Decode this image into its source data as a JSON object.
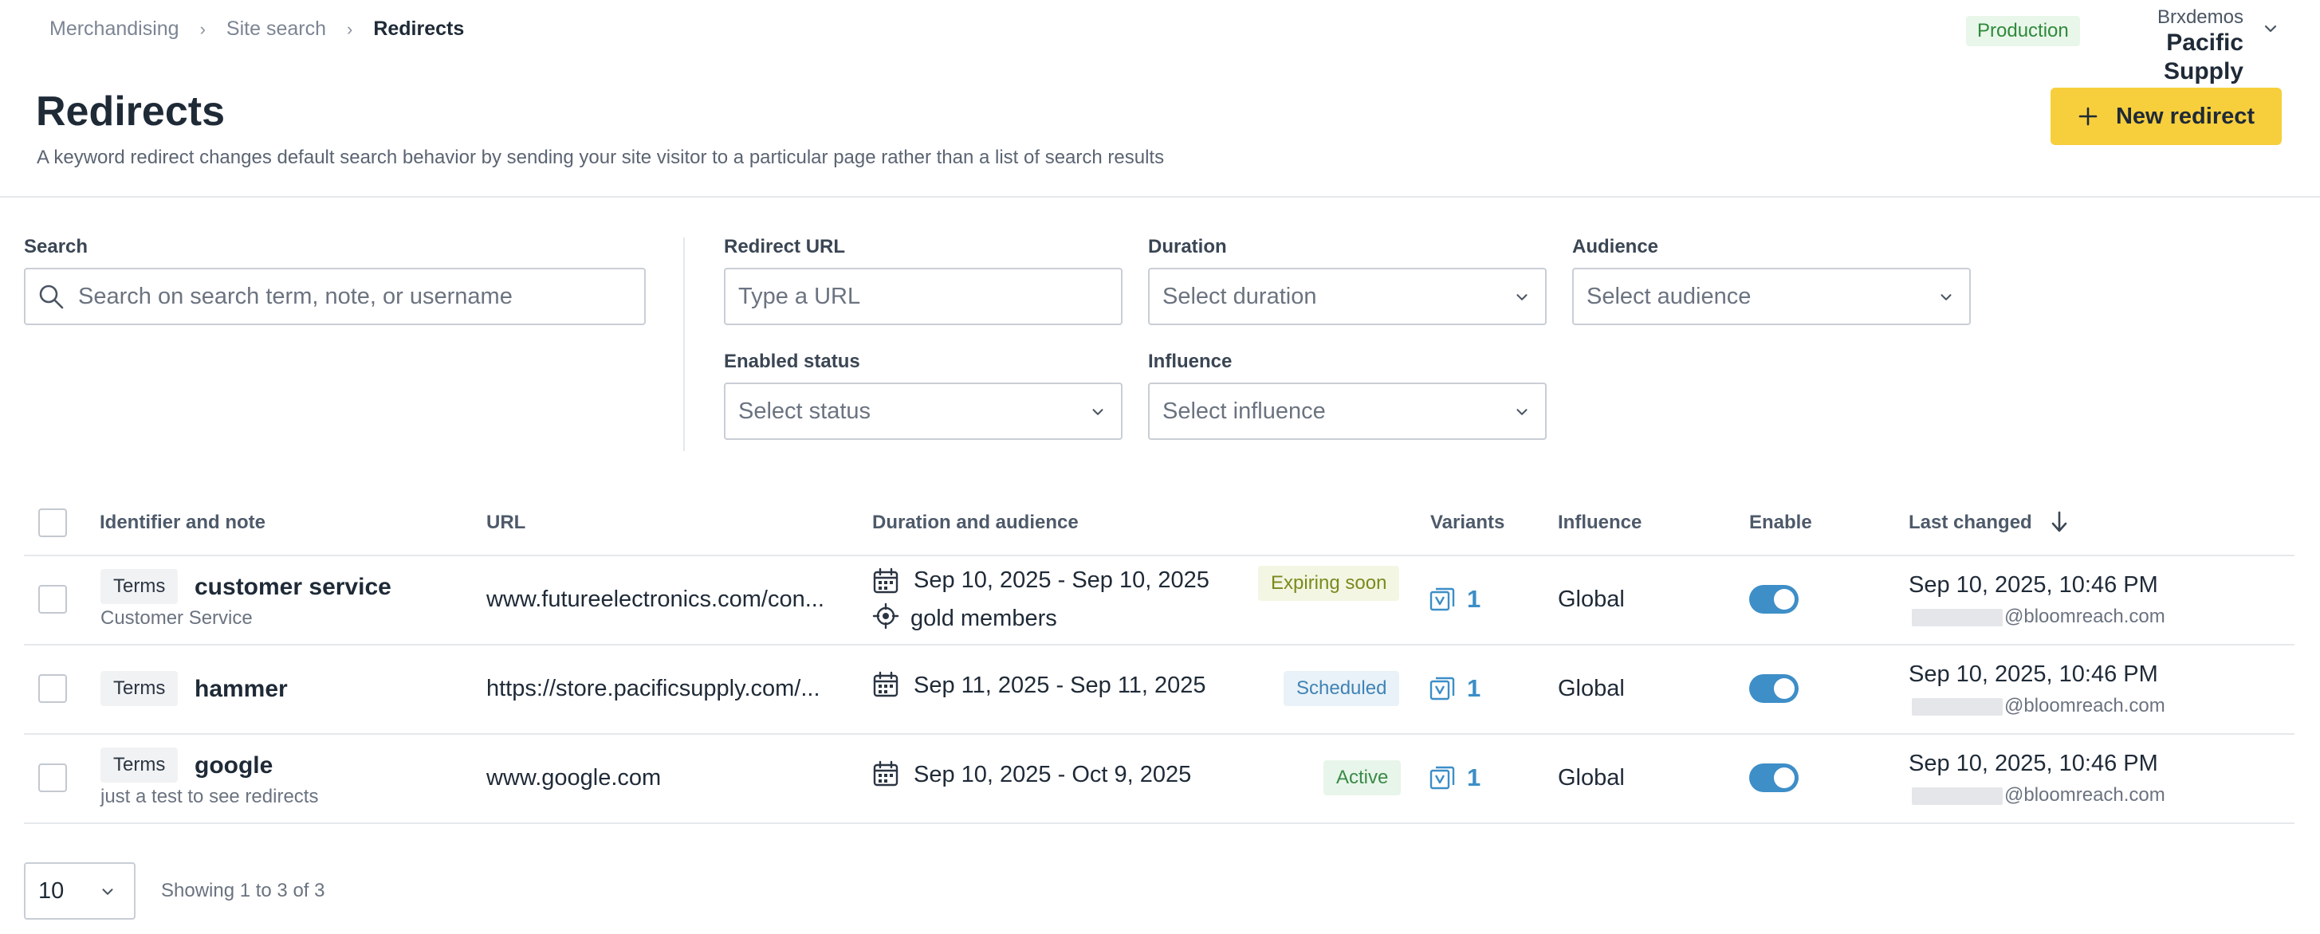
{
  "breadcrumb": [
    "Merchandising",
    "Site search",
    "Redirects"
  ],
  "environment": "Production",
  "account": {
    "org": "Brxdemos",
    "name": "Pacific Supply"
  },
  "page": {
    "title": "Redirects",
    "description": "A keyword redirect changes default search behavior by sending your site visitor to a particular page rather than a list of search results",
    "new_button": "New redirect"
  },
  "filters": {
    "search": {
      "label": "Search",
      "placeholder": "Search on search term, note, or username"
    },
    "redirect_url": {
      "label": "Redirect URL",
      "placeholder": "Type a URL"
    },
    "duration": {
      "label": "Duration",
      "placeholder": "Select duration"
    },
    "audience": {
      "label": "Audience",
      "placeholder": "Select audience"
    },
    "enabled_status": {
      "label": "Enabled status",
      "placeholder": "Select status"
    },
    "influence": {
      "label": "Influence",
      "placeholder": "Select influence"
    }
  },
  "table": {
    "columns": [
      "Identifier and note",
      "URL",
      "Duration and audience",
      "Variants",
      "Influence",
      "Enable",
      "Last changed"
    ],
    "rows": [
      {
        "type": "Terms",
        "identifier": "customer service",
        "note": "Customer Service",
        "url": "www.futureelectronics.com/con...",
        "duration": "Sep 10, 2025 - Sep 10, 2025",
        "audience": "gold members",
        "status": "Expiring soon",
        "variants": "1",
        "influence": "Global",
        "enabled": true,
        "last_changed": "Sep 10, 2025, 10:46 PM",
        "email": "@bloomreach.com"
      },
      {
        "type": "Terms",
        "identifier": "hammer",
        "note": "",
        "url": "https://store.pacificsupply.com/...",
        "duration": "Sep 11, 2025 - Sep 11, 2025",
        "audience": "",
        "status": "Scheduled",
        "variants": "1",
        "influence": "Global",
        "enabled": true,
        "last_changed": "Sep 10, 2025, 10:46 PM",
        "email": "@bloomreach.com"
      },
      {
        "type": "Terms",
        "identifier": "google",
        "note": "just a test to see redirects",
        "url": "www.google.com",
        "duration": "Sep 10, 2025 - Oct 9, 2025",
        "audience": "",
        "status": "Active",
        "variants": "1",
        "influence": "Global",
        "enabled": true,
        "last_changed": "Sep 10, 2025, 10:46 PM",
        "email": "@bloomreach.com"
      }
    ]
  },
  "pagination": {
    "page_size": "10",
    "showing": "Showing 1 to 3 of 3"
  }
}
